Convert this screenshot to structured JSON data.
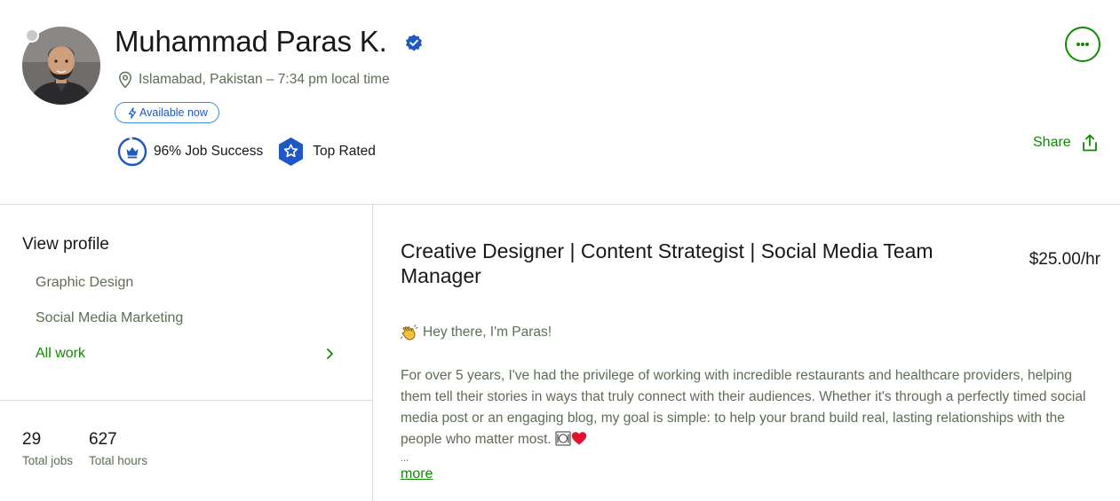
{
  "profile": {
    "name": "Muhammad Paras K.",
    "location": "Islamabad, Pakistan – 7:34 pm local time",
    "availability": "Available now",
    "job_success": "96% Job Success",
    "job_success_percent": 96,
    "badge": "Top Rated",
    "online_status": "offline"
  },
  "actions": {
    "share_label": "Share",
    "more_options_icon": "ellipsis-icon"
  },
  "sidebar": {
    "heading": "View profile",
    "items": [
      {
        "label": "Graphic Design"
      },
      {
        "label": "Social Media Marketing"
      }
    ],
    "all_work_label": "All work",
    "stats": [
      {
        "value": "29",
        "label": "Total jobs"
      },
      {
        "value": "627",
        "label": "Total hours"
      }
    ]
  },
  "main": {
    "title": "Creative Designer | Content Strategist | Social Media Team Manager",
    "rate": "$25.00/hr",
    "greeting": "Hey there, I'm Paras!",
    "description": "For over 5 years, I've had the privilege of working with incredible restaurants and healthcare providers, helping them tell their stories in ways that truly connect with their audiences. Whether it's through a perfectly timed social media post or an engaging blog, my goal is simple: to help your brand build real, lasting relationships with the people who matter most.",
    "ellipsis": "...",
    "more_label": "more"
  },
  "colors": {
    "brand_green": "#108a00",
    "verified_blue": "#1f57c3",
    "muted_text": "#5e6d55",
    "divider": "#d5e0d5"
  }
}
